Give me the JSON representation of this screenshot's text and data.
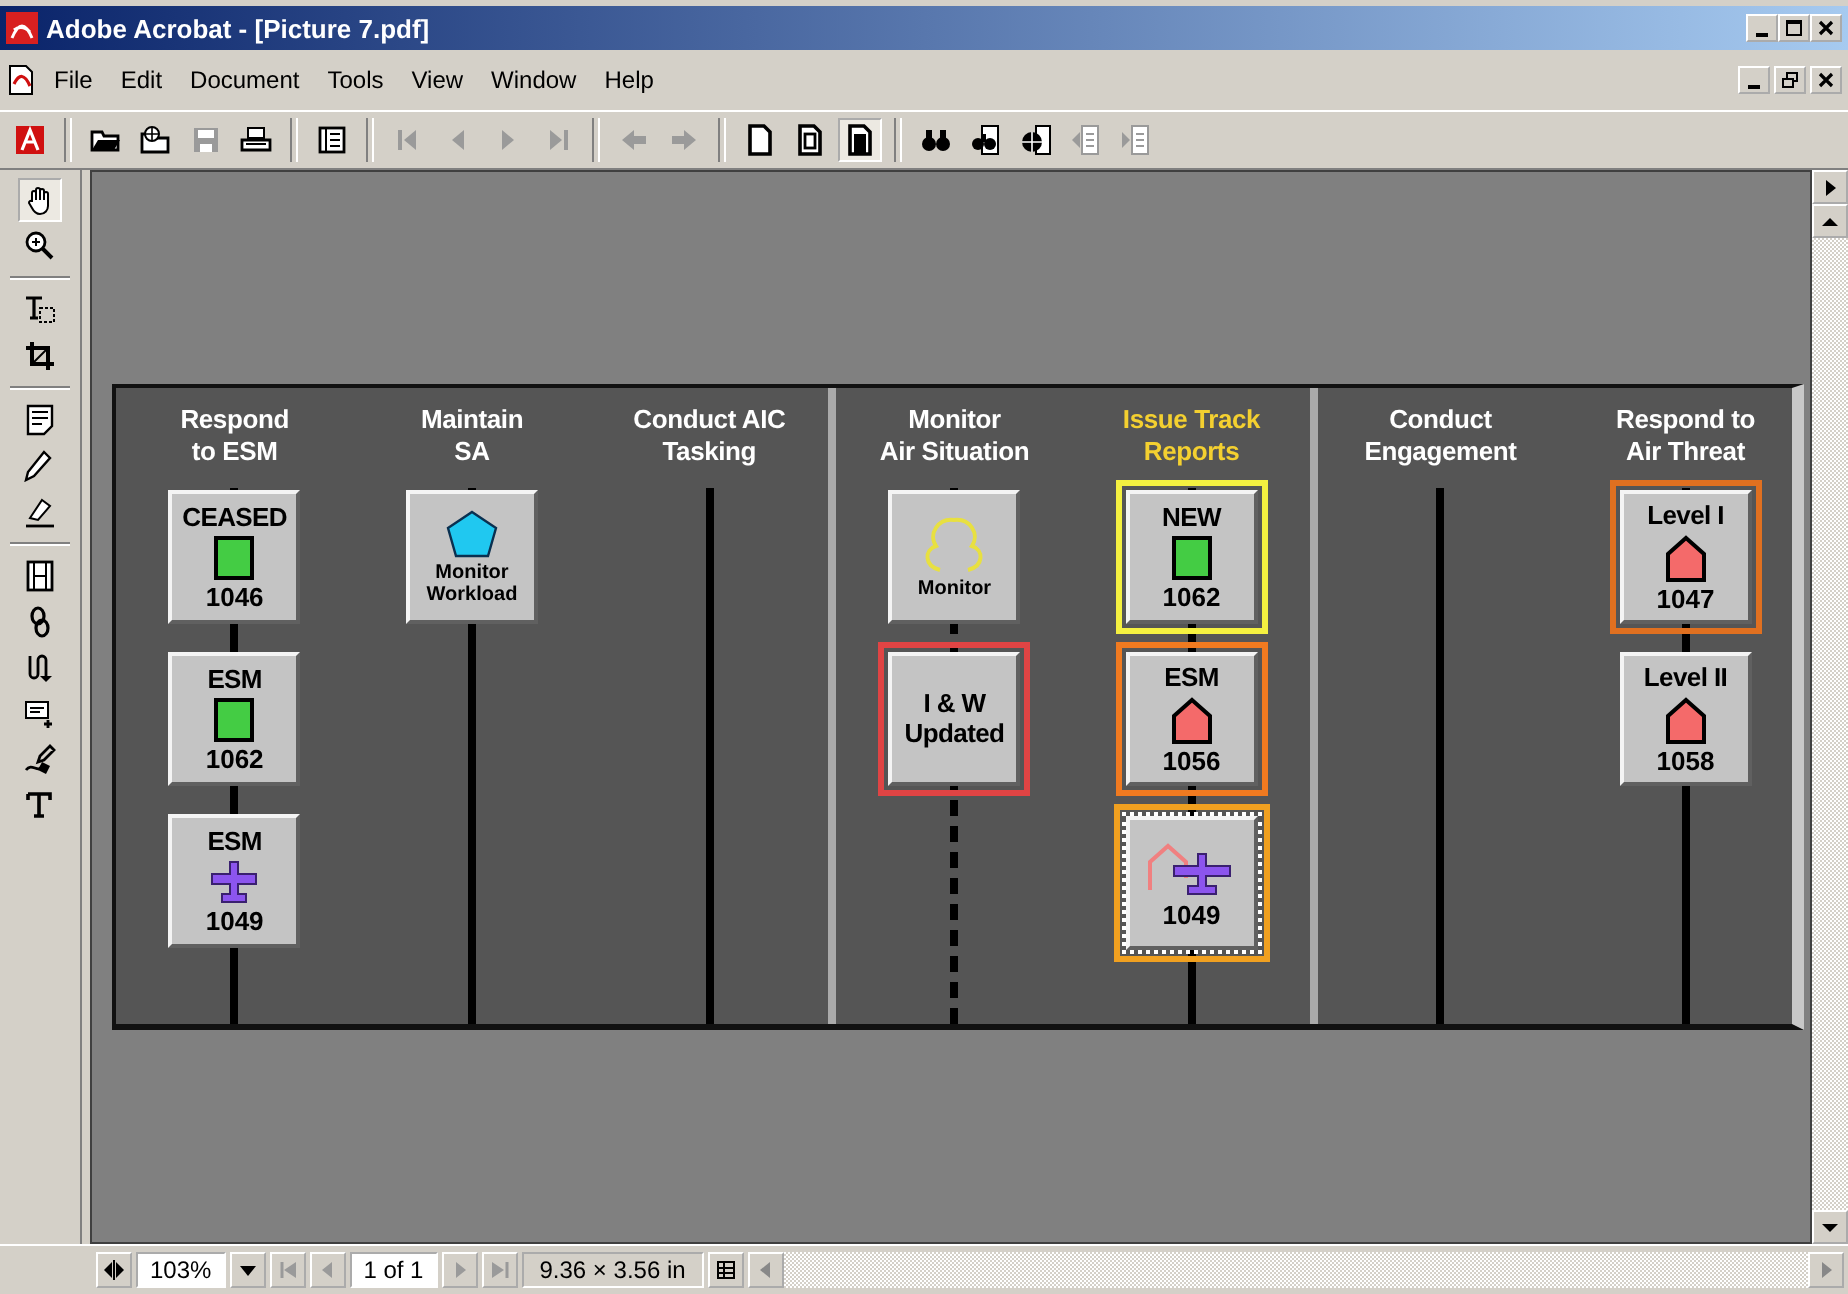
{
  "window": {
    "title": "Adobe Acrobat - [Picture 7.pdf]"
  },
  "menu": [
    "File",
    "Edit",
    "Document",
    "Tools",
    "View",
    "Window",
    "Help"
  ],
  "toolbar": [
    {
      "kind": "logo",
      "selected": false
    },
    {
      "kind": "sep"
    },
    {
      "kind": "open",
      "disabled": false,
      "selected": false
    },
    {
      "kind": "open-web",
      "disabled": false,
      "selected": false
    },
    {
      "kind": "save",
      "disabled": true,
      "selected": false
    },
    {
      "kind": "print",
      "disabled": false,
      "selected": false
    },
    {
      "kind": "sep"
    },
    {
      "kind": "pane",
      "disabled": false,
      "selected": false
    },
    {
      "kind": "sep"
    },
    {
      "kind": "first",
      "disabled": true,
      "selected": false
    },
    {
      "kind": "prev",
      "disabled": true,
      "selected": false
    },
    {
      "kind": "next",
      "disabled": true,
      "selected": false
    },
    {
      "kind": "last",
      "disabled": true,
      "selected": false
    },
    {
      "kind": "sep"
    },
    {
      "kind": "back",
      "disabled": true,
      "selected": false
    },
    {
      "kind": "forward",
      "disabled": true,
      "selected": false
    },
    {
      "kind": "sep"
    },
    {
      "kind": "page",
      "disabled": false,
      "selected": false
    },
    {
      "kind": "fit-page",
      "disabled": false,
      "selected": false
    },
    {
      "kind": "fit-width",
      "disabled": false,
      "selected": true
    },
    {
      "kind": "sep"
    },
    {
      "kind": "find",
      "disabled": false,
      "selected": false
    },
    {
      "kind": "search",
      "disabled": false,
      "selected": false
    },
    {
      "kind": "capture",
      "disabled": false,
      "selected": false
    },
    {
      "kind": "hl-prev",
      "disabled": true,
      "selected": false
    },
    {
      "kind": "hl-next",
      "disabled": true,
      "selected": false
    }
  ],
  "tools": [
    {
      "kind": "hand",
      "selected": true
    },
    {
      "kind": "zoom",
      "selected": false
    },
    {
      "kind": "sep"
    },
    {
      "kind": "text-select",
      "selected": false
    },
    {
      "kind": "crop",
      "selected": false
    },
    {
      "kind": "sep"
    },
    {
      "kind": "note",
      "selected": false
    },
    {
      "kind": "pencil",
      "selected": false
    },
    {
      "kind": "highlighter",
      "selected": false
    },
    {
      "kind": "sep"
    },
    {
      "kind": "movie",
      "selected": false
    },
    {
      "kind": "link",
      "selected": false
    },
    {
      "kind": "article",
      "selected": false
    },
    {
      "kind": "form",
      "selected": false
    },
    {
      "kind": "signature",
      "selected": false
    },
    {
      "kind": "touchup",
      "selected": false
    }
  ],
  "diagram": {
    "sections": [
      {
        "columns": [
          {
            "title": "Respond\nto ESM",
            "highlighted": false,
            "dotted": false,
            "cards": [
              {
                "kind": "square",
                "label": "CEASED",
                "number": "1046",
                "framed": false
              },
              {
                "kind": "square",
                "label": "ESM",
                "number": "1062",
                "framed": false
              },
              {
                "kind": "plane",
                "label": "ESM",
                "number": "1049",
                "framed": false
              }
            ]
          },
          {
            "title": "Maintain\nSA",
            "highlighted": false,
            "dotted": false,
            "cards": [
              {
                "kind": "pentagon",
                "caption": "Monitor\nWorkload",
                "framed": false
              }
            ]
          },
          {
            "title": "Conduct AIC\nTasking",
            "highlighted": false,
            "dotted": false
          }
        ]
      },
      {
        "columns": [
          {
            "title": "Monitor\nAir Situation",
            "highlighted": false,
            "dotted": true,
            "cards": [
              {
                "kind": "cloud",
                "caption": "Monitor",
                "framed": false
              },
              {
                "kind": "text",
                "label": "I & W\nUpdated",
                "framed": true,
                "dotted": false,
                "color": "#e04444"
              }
            ]
          },
          {
            "title": "Issue Track\nReports",
            "highlighted": true,
            "dotted": false,
            "cards": [
              {
                "kind": "square",
                "label": "NEW",
                "number": "1062",
                "framed": true,
                "dotted": false,
                "color": "#f4f040"
              },
              {
                "kind": "house",
                "label": "ESM",
                "number": "1056",
                "framed": true,
                "dotted": false,
                "color": "#f07a20"
              },
              {
                "kind": "house-plane",
                "number": "1049",
                "framed": true,
                "dotted": true,
                "color": "#f0a020"
              }
            ]
          }
        ]
      },
      {
        "columns": [
          {
            "title": "Conduct\nEngagement",
            "highlighted": false,
            "dotted": false
          },
          {
            "title": "Respond to\nAir Threat",
            "highlighted": false,
            "dotted": false,
            "cards": [
              {
                "kind": "house",
                "label": "Level I",
                "number": "1047",
                "framed": true,
                "dotted": false,
                "color": "#e07020"
              },
              {
                "kind": "house",
                "label": "Level II",
                "number": "1058",
                "framed": false
              }
            ]
          }
        ]
      }
    ]
  },
  "status_bar": {
    "zoom": "103%",
    "page": "1 of 1",
    "page_size": "9.36 × 3.56 in",
    "nav": [
      {
        "kind": "first",
        "disabled": true
      },
      {
        "kind": "prev",
        "disabled": true
      },
      {
        "kind": "next",
        "disabled": true
      },
      {
        "kind": "last",
        "disabled": true
      }
    ]
  }
}
